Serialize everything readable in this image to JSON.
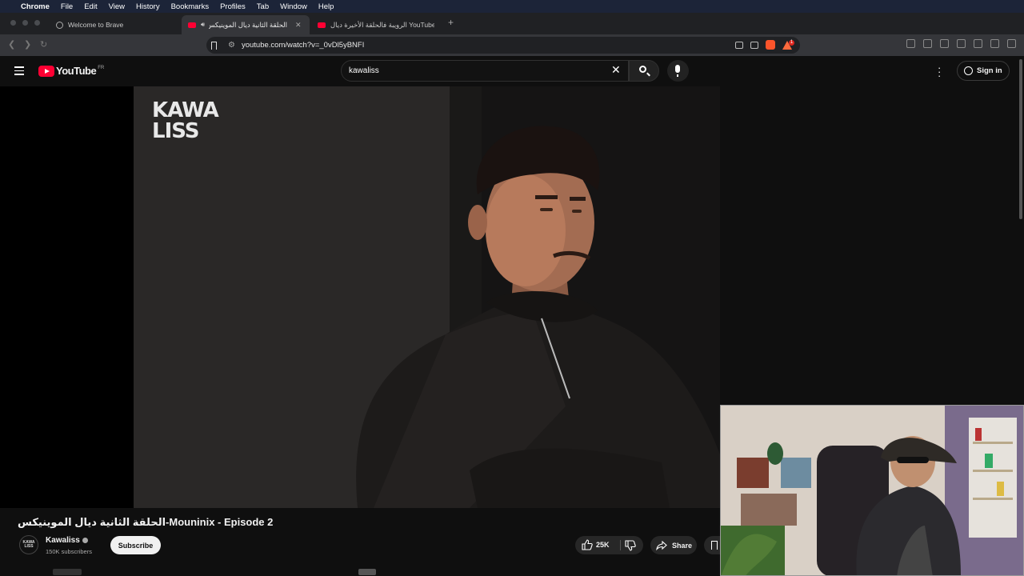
{
  "menubar": {
    "items": [
      "Chrome",
      "File",
      "Edit",
      "View",
      "History",
      "Bookmarks",
      "Profiles",
      "Tab",
      "Window",
      "Help"
    ]
  },
  "tabs": [
    {
      "title": "Welcome to Brave",
      "icon": "globe-icon",
      "active": false
    },
    {
      "title": "الحلقة الثانية ديال الموينيكس-",
      "icon": "youtube-icon",
      "active": true,
      "audio": true
    },
    {
      "title": "الرويبة فالحلقة الأخيرة ديال YouTube -",
      "icon": "youtube-icon",
      "active": false
    }
  ],
  "toolbar": {
    "url": "youtube.com/watch?v=_0vDl5yBNFI",
    "shields_badge": "1"
  },
  "youtube": {
    "logo_text": "YouTube",
    "logo_country": "FR",
    "search_value": "kawaliss",
    "signin_label": "Sign in"
  },
  "video": {
    "watermark_line1": "KAWA",
    "watermark_line2": "LISS",
    "title": "الحلقة الثانية ديال الموينيكس-Mouninix - Episode 2",
    "channel_name": "Kawaliss",
    "channel_avatar_text": "KAWA LISS",
    "subscribers": "150K subscribers",
    "subscribe_label": "Subscribe",
    "like_count": "25K",
    "share_label": "Share"
  },
  "colors": {
    "youtube_red": "#ff0033",
    "background": "#0f0f0f",
    "brave_orange": "#fb542b"
  }
}
